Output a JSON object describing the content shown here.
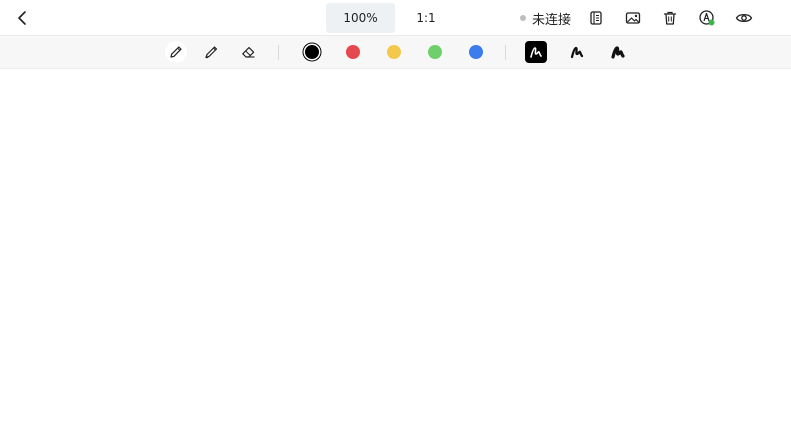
{
  "header": {
    "zoom_label": "100%",
    "ratio_label": "1:1",
    "connection_status": "未连接"
  },
  "colors": {
    "black": "#000000",
    "red": "#e5484d",
    "yellow": "#f2c94c",
    "green": "#6fcf6b",
    "blue": "#3b7ded",
    "connection_dot": "#bdbdbd",
    "sync_badge": "#3bb54a"
  },
  "toolbar": {
    "tools": [
      "pencil-icon",
      "highlighter-icon",
      "eraser-icon"
    ],
    "active_tool": "pencil",
    "selected_color": "black",
    "stroke_widths": [
      "thin",
      "medium",
      "thick"
    ],
    "active_stroke": "thin"
  }
}
